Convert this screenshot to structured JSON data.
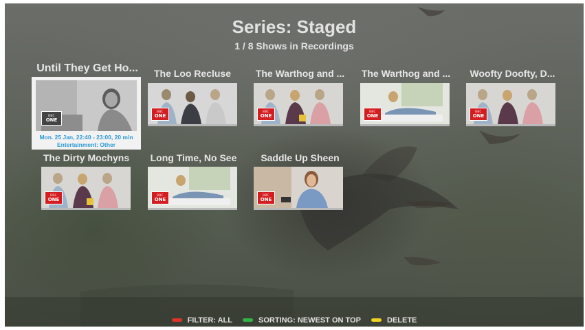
{
  "header": {
    "title": "Series: Staged",
    "subtitle": "1 / 8 Shows in Recordings"
  },
  "tiles": [
    {
      "label": "Until They Get Ho...",
      "channel": "ONE",
      "focused": true,
      "info_line1": "Mon. 25 Jan, 22:40 - 23:00, 20 min",
      "info_line2": "Entertainment: Other"
    },
    {
      "label": "The Loo Recluse",
      "channel": "ONE"
    },
    {
      "label": "The Warthog and ...",
      "channel": "ONE"
    },
    {
      "label": "The Warthog and ...",
      "channel": "ONE"
    },
    {
      "label": "Woofty Doofty, D...",
      "channel": "ONE"
    },
    {
      "label": "The Dirty Mochyns",
      "channel": "ONE"
    },
    {
      "label": "Long Time, No See",
      "channel": "ONE"
    },
    {
      "label": "Saddle Up Sheen",
      "channel": "ONE"
    }
  ],
  "footer": {
    "filter_label": "FILTER: ALL",
    "sorting_label": "SORTING: NEWEST ON TOP",
    "delete_label": "DELETE"
  },
  "colors": {
    "red_key": "#e0342a",
    "green_key": "#2fb544",
    "yellow_key": "#f0d320",
    "info_text": "#2e9ad6"
  },
  "icons": {
    "channel_logo": "bbc-one-logo"
  }
}
